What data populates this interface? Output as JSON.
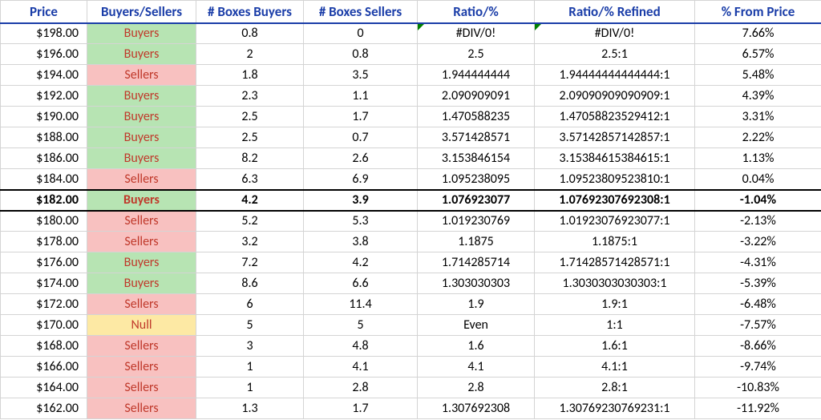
{
  "headers": {
    "price": "Price",
    "bs": "Buyers/Sellers",
    "nbb": "# Boxes Buyers",
    "nbs": "# Boxes Sellers",
    "ratio": "Ratio/%",
    "rref": "Ratio/% Refined",
    "pct": "% From Price"
  },
  "rows": [
    {
      "price": "$198.00",
      "bs": "Buyers",
      "nbb": "0.8",
      "nbs": "0",
      "ratio": "#DIV/0!",
      "rref": "#DIV/0!",
      "pct": "7.66%"
    },
    {
      "price": "$196.00",
      "bs": "Buyers",
      "nbb": "2",
      "nbs": "0.8",
      "ratio": "2.5",
      "rref": "2.5:1",
      "pct": "6.57%"
    },
    {
      "price": "$194.00",
      "bs": "Sellers",
      "nbb": "1.8",
      "nbs": "3.5",
      "ratio": "1.944444444",
      "rref": "1.94444444444444:1",
      "pct": "5.48%"
    },
    {
      "price": "$192.00",
      "bs": "Buyers",
      "nbb": "2.3",
      "nbs": "1.1",
      "ratio": "2.090909091",
      "rref": "2.09090909090909:1",
      "pct": "4.39%"
    },
    {
      "price": "$190.00",
      "bs": "Buyers",
      "nbb": "2.5",
      "nbs": "1.7",
      "ratio": "1.470588235",
      "rref": "1.47058823529412:1",
      "pct": "3.31%"
    },
    {
      "price": "$188.00",
      "bs": "Buyers",
      "nbb": "2.5",
      "nbs": "0.7",
      "ratio": "3.571428571",
      "rref": "3.57142857142857:1",
      "pct": "2.22%"
    },
    {
      "price": "$186.00",
      "bs": "Buyers",
      "nbb": "8.2",
      "nbs": "2.6",
      "ratio": "3.153846154",
      "rref": "3.15384615384615:1",
      "pct": "1.13%"
    },
    {
      "price": "$184.00",
      "bs": "Sellers",
      "nbb": "6.3",
      "nbs": "6.9",
      "ratio": "1.095238095",
      "rref": "1.09523809523810:1",
      "pct": "0.04%"
    },
    {
      "price": "$182.00",
      "bs": "Buyers",
      "nbb": "4.2",
      "nbs": "3.9",
      "ratio": "1.076923077",
      "rref": "1.07692307692308:1",
      "pct": "-1.04%",
      "highlight": true
    },
    {
      "price": "$180.00",
      "bs": "Sellers",
      "nbb": "5.2",
      "nbs": "5.3",
      "ratio": "1.019230769",
      "rref": "1.01923076923077:1",
      "pct": "-2.13%"
    },
    {
      "price": "$178.00",
      "bs": "Sellers",
      "nbb": "3.2",
      "nbs": "3.8",
      "ratio": "1.1875",
      "rref": "1.1875:1",
      "pct": "-3.22%"
    },
    {
      "price": "$176.00",
      "bs": "Buyers",
      "nbb": "7.2",
      "nbs": "4.2",
      "ratio": "1.714285714",
      "rref": "1.71428571428571:1",
      "pct": "-4.31%"
    },
    {
      "price": "$174.00",
      "bs": "Buyers",
      "nbb": "8.6",
      "nbs": "6.6",
      "ratio": "1.303030303",
      "rref": "1.3030303030303:1",
      "pct": "-5.39%"
    },
    {
      "price": "$172.00",
      "bs": "Sellers",
      "nbb": "6",
      "nbs": "11.4",
      "ratio": "1.9",
      "rref": "1.9:1",
      "pct": "-6.48%"
    },
    {
      "price": "$170.00",
      "bs": "Null",
      "nbb": "5",
      "nbs": "5",
      "ratio": "Even",
      "rref": "1:1",
      "pct": "-7.57%"
    },
    {
      "price": "$168.00",
      "bs": "Sellers",
      "nbb": "3",
      "nbs": "4.8",
      "ratio": "1.6",
      "rref": "1.6:1",
      "pct": "-8.66%"
    },
    {
      "price": "$166.00",
      "bs": "Sellers",
      "nbb": "1",
      "nbs": "4.1",
      "ratio": "4.1",
      "rref": "4.1:1",
      "pct": "-9.74%"
    },
    {
      "price": "$164.00",
      "bs": "Sellers",
      "nbb": "1",
      "nbs": "2.8",
      "ratio": "2.8",
      "rref": "2.8:1",
      "pct": "-10.83%"
    },
    {
      "price": "$162.00",
      "bs": "Sellers",
      "nbb": "1.3",
      "nbs": "1.7",
      "ratio": "1.307692308",
      "rref": "1.30769230769231:1",
      "pct": "-11.92%"
    }
  ]
}
